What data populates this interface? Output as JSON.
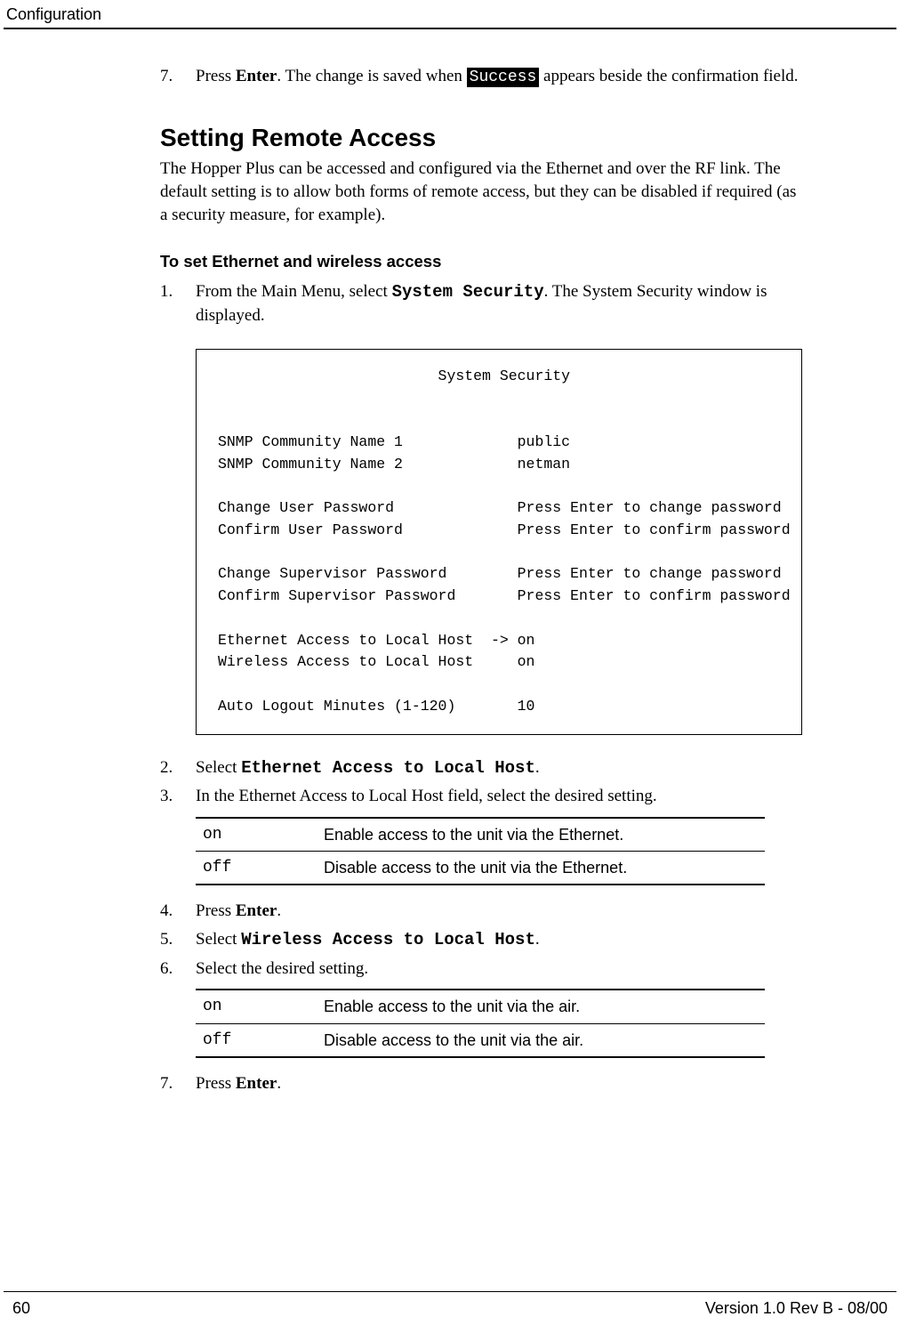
{
  "header": {
    "left": "Configuration"
  },
  "step7a": {
    "num": "7.",
    "pre": "Press ",
    "enter": "Enter",
    "mid": ". The change is saved when ",
    "success": "Success",
    "post": " appears beside the confirmation field."
  },
  "section_title": "Setting Remote Access",
  "intro": "The Hopper Plus can be accessed and configured via the Ethernet and over the RF link. The default setting is to allow both forms of remote access, but they can be disabled if required (as a security measure, for example).",
  "sub_heading": "To set Ethernet and wireless access",
  "step1": {
    "num": "1.",
    "pre": "From the Main Menu, select ",
    "cmd": "System Security",
    "post": ". The System Security window is displayed."
  },
  "screen": "                         System Security\n\n\nSNMP Community Name 1             public\nSNMP Community Name 2             netman\n\nChange User Password              Press Enter to change password\nConfirm User Password             Press Enter to confirm password\n\nChange Supervisor Password        Press Enter to change password\nConfirm Supervisor Password       Press Enter to confirm password\n\nEthernet Access to Local Host  -> on\nWireless Access to Local Host     on\n\nAuto Logout Minutes (1-120)       10",
  "step2": {
    "num": "2.",
    "pre": "Select ",
    "cmd": "Ethernet Access to Local Host",
    "post": "."
  },
  "step3": {
    "num": "3.",
    "text": "In the Ethernet Access to Local Host field, select the desired setting."
  },
  "table1": {
    "rows": [
      {
        "key": "on",
        "desc": "Enable access to the unit via the Ethernet."
      },
      {
        "key": "off",
        "desc": "Disable access to the unit via the Ethernet."
      }
    ]
  },
  "step4": {
    "num": "4.",
    "pre": "Press ",
    "enter": "Enter",
    "post": "."
  },
  "step5": {
    "num": "5.",
    "pre": "Select ",
    "cmd": "Wireless Access to Local Host",
    "post": "."
  },
  "step6": {
    "num": "6.",
    "text": "Select the desired setting."
  },
  "table2": {
    "rows": [
      {
        "key": "on",
        "desc": "Enable access to the unit via the air."
      },
      {
        "key": "off",
        "desc": "Disable access to the unit via the air."
      }
    ]
  },
  "step7b": {
    "num": "7.",
    "pre": "Press ",
    "enter": "Enter",
    "post": "."
  },
  "footer": {
    "page": "60",
    "version": "Version 1.0 Rev B - 08/00"
  }
}
